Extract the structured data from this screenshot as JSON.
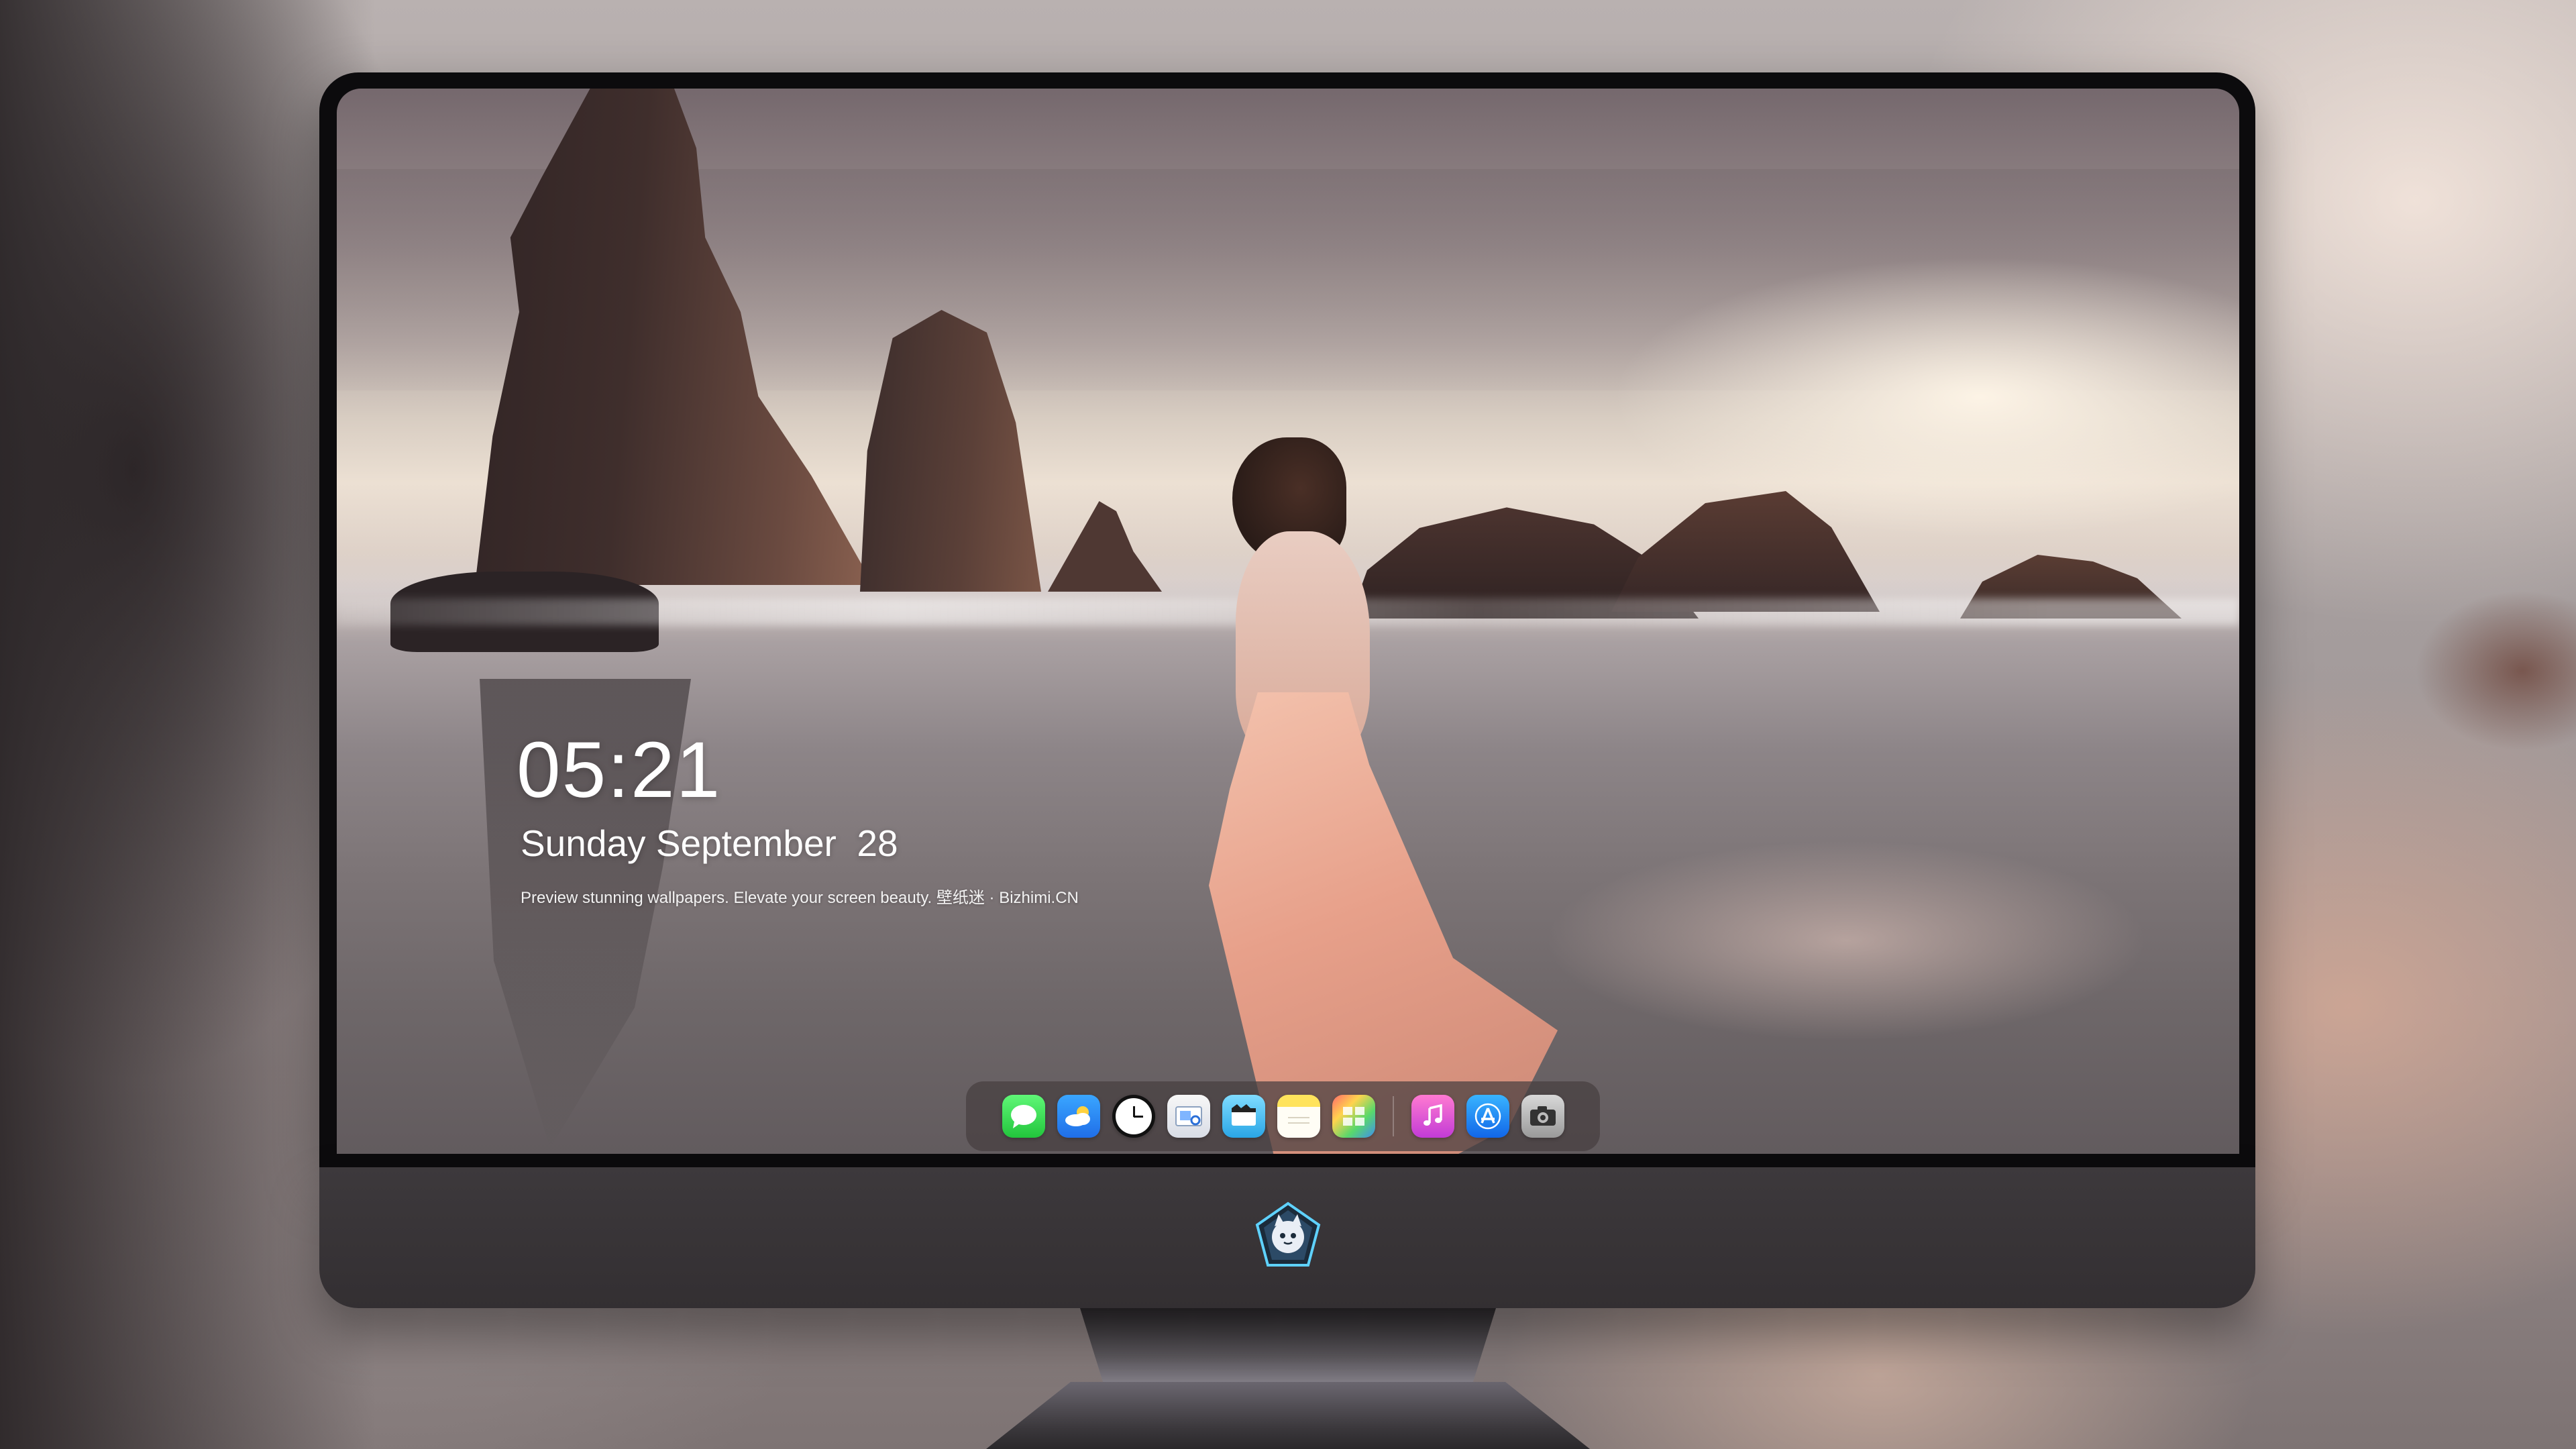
{
  "lockscreen": {
    "time": "05:21",
    "date": "Sunday September  28",
    "caption": "Preview stunning wallpapers. Elevate your screen beauty. 壁纸迷 · Bizhimi.CN"
  },
  "dock": {
    "apps": [
      {
        "name": "Messages",
        "icon": "messages-icon",
        "glyph": "💬"
      },
      {
        "name": "Weather",
        "icon": "weather-icon",
        "glyph": "⛅"
      },
      {
        "name": "Clock",
        "icon": "clock-icon"
      },
      {
        "name": "Preview",
        "icon": "preview-icon",
        "glyph": "▣"
      },
      {
        "name": "Clips",
        "icon": "clips-icon",
        "glyph": "🎬"
      },
      {
        "name": "Notes",
        "icon": "notes-icon",
        "glyph": "≡"
      },
      {
        "name": "Photo Booth",
        "icon": "photo-booth-icon",
        "glyph": "▦"
      },
      {
        "name": "Music",
        "icon": "music-icon",
        "glyph": "♫"
      },
      {
        "name": "App Store",
        "icon": "app-store-icon",
        "glyph": "Ⓐ"
      },
      {
        "name": "Camera",
        "icon": "camera-icon",
        "glyph": "📷"
      }
    ]
  },
  "branding": {
    "logo": "cat-mascot-logo"
  }
}
